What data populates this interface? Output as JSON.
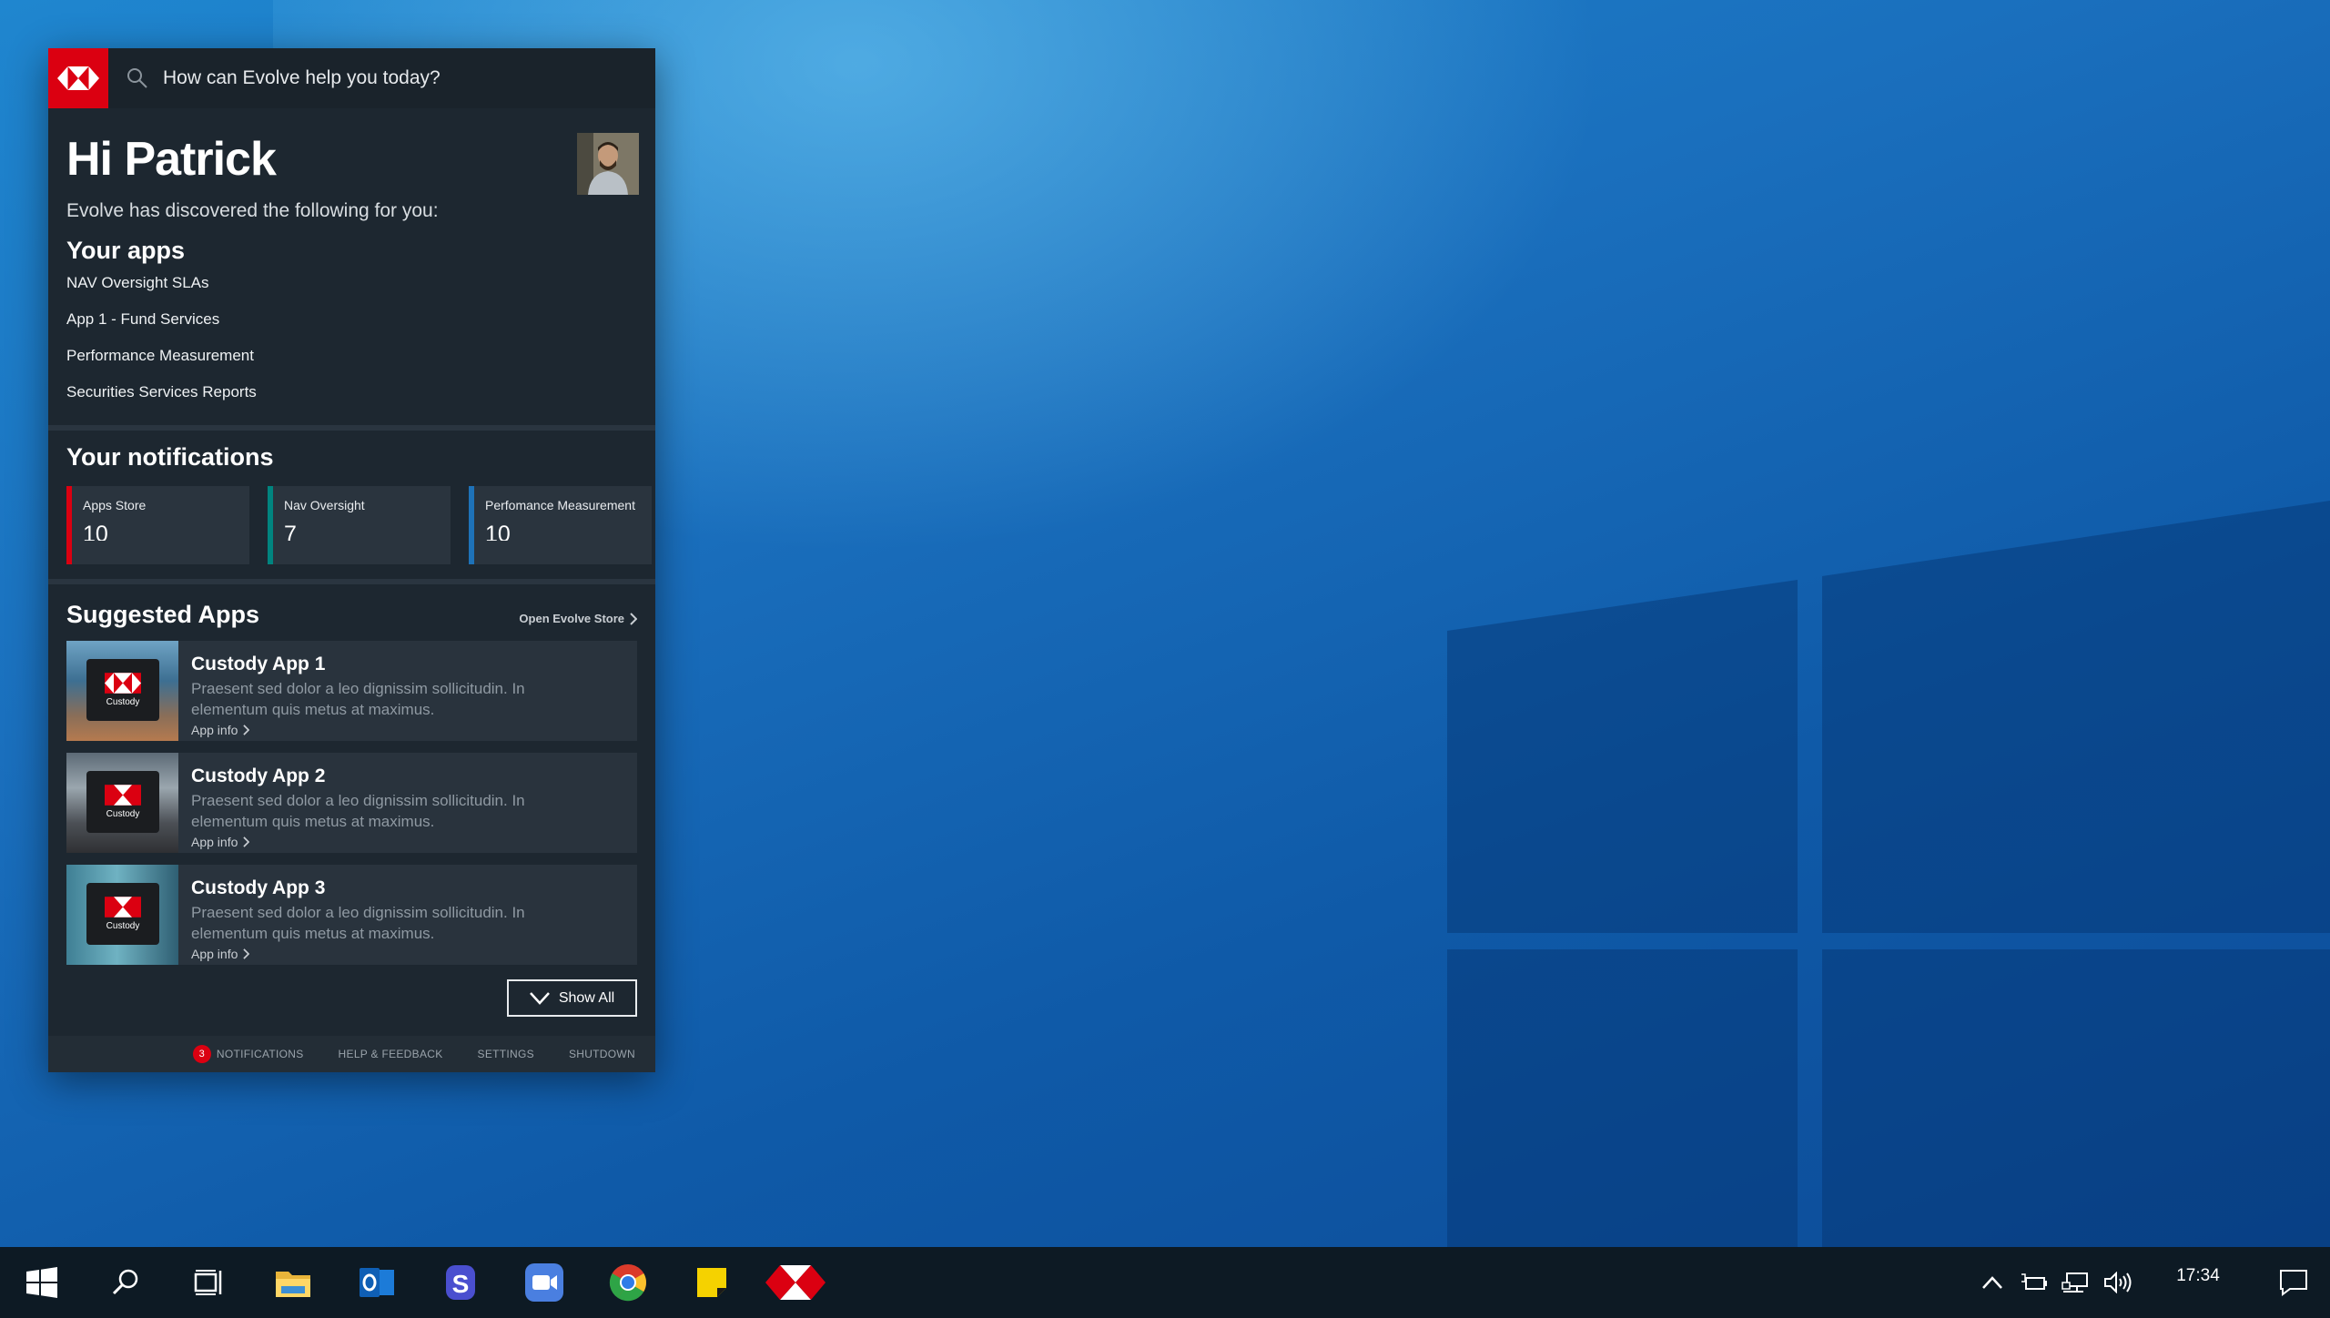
{
  "panel": {
    "search_placeholder": "How can Evolve help you today?",
    "greeting": "Hi Patrick",
    "discovered": "Evolve has discovered the following for you:",
    "apps_title": "Your apps",
    "apps": [
      {
        "label": "NAV Oversight SLAs"
      },
      {
        "label": "App 1 - Fund Services"
      },
      {
        "label": "Performance Measurement"
      },
      {
        "label": "Securities Services Reports"
      }
    ],
    "notifications_title": "Your notifications",
    "notifications": [
      {
        "label": "Apps Store",
        "count": "10",
        "color": "#db0011"
      },
      {
        "label": "Nav Oversight",
        "count": "7",
        "color": "#00847f"
      },
      {
        "label": "Perfomance Measurement",
        "count": "10",
        "color": "#1e72b8"
      }
    ],
    "suggested_title": "Suggested Apps",
    "open_store": "Open Evolve Store",
    "suggested_apps": [
      {
        "name": "Custody App 1",
        "description": "Praesent sed dolor a leo dignissim sollicitudin. In elementum quis metus at maximus.",
        "info": "App info",
        "badge": "Custody"
      },
      {
        "name": "Custody App 2",
        "description": "Praesent sed dolor a leo dignissim sollicitudin. In elementum quis metus at maximus.",
        "info": "App info",
        "badge": "Custody"
      },
      {
        "name": "Custody App 3",
        "description": "Praesent sed dolor a leo dignissim sollicitudin. In elementum quis metus at maximus.",
        "info": "App info",
        "badge": "Custody"
      }
    ],
    "show_all": "Show All",
    "footer": {
      "notifications": "NOTIFICATIONS",
      "notification_count": "3",
      "help": "HELP & FEEDBACK",
      "settings": "SETTINGS",
      "shutdown": "SHUTDOWN"
    }
  },
  "taskbar": {
    "clock": "17:34",
    "apps": [
      "start-icon",
      "search-icon",
      "task-view-icon",
      "file-explorer-icon",
      "outlook-icon",
      "skype-icon",
      "zoom-icon",
      "chrome-icon",
      "sticky-notes-icon",
      "hsbc-evolve-icon"
    ]
  },
  "colors": {
    "brand_red": "#db0011",
    "panel_bg": "#1d2730",
    "desktop_blue": "#1a6fbd"
  }
}
